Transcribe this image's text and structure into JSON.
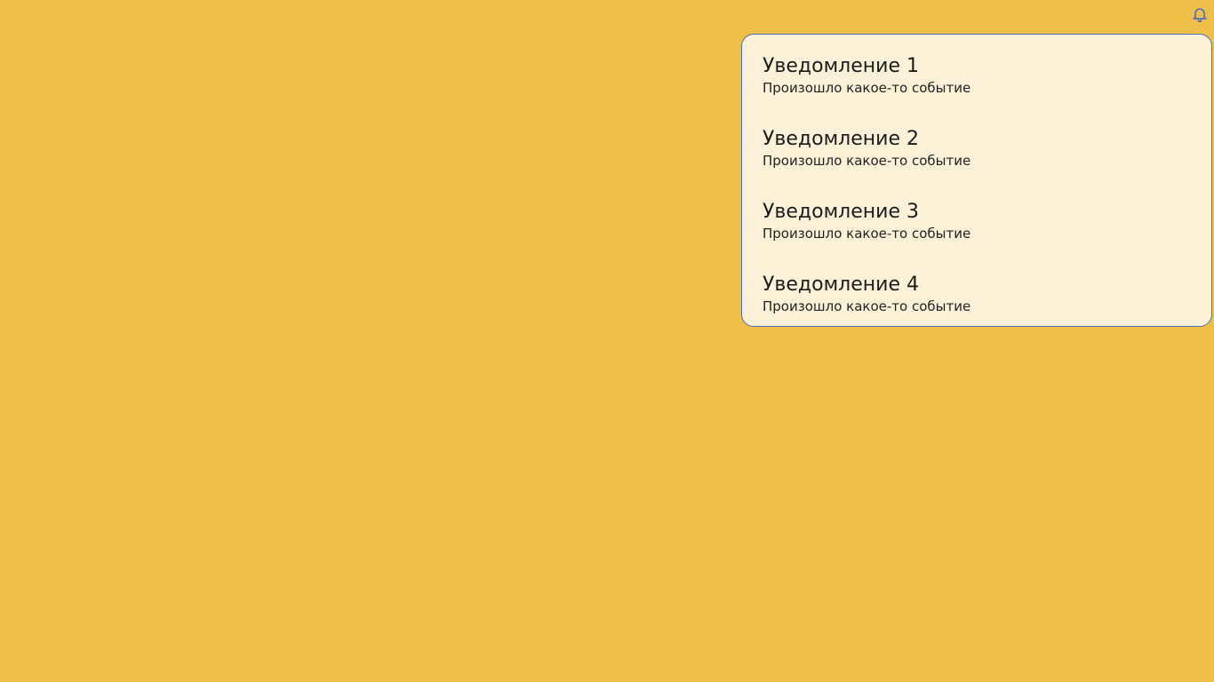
{
  "colors": {
    "background": "#f0bf48",
    "panel_background": "#fdf2d8",
    "panel_border": "#4d6fbf",
    "bell_icon": "#4d6fbf"
  },
  "header": {
    "bell_icon": "bell-icon"
  },
  "notifications": {
    "items": [
      {
        "title": "Уведомление 1",
        "text": "Произошло какое-то событие"
      },
      {
        "title": "Уведомление 2",
        "text": "Произошло какое-то событие"
      },
      {
        "title": "Уведомление 3",
        "text": "Произошло какое-то событие"
      },
      {
        "title": "Уведомление 4",
        "text": "Произошло какое-то событие"
      }
    ]
  }
}
